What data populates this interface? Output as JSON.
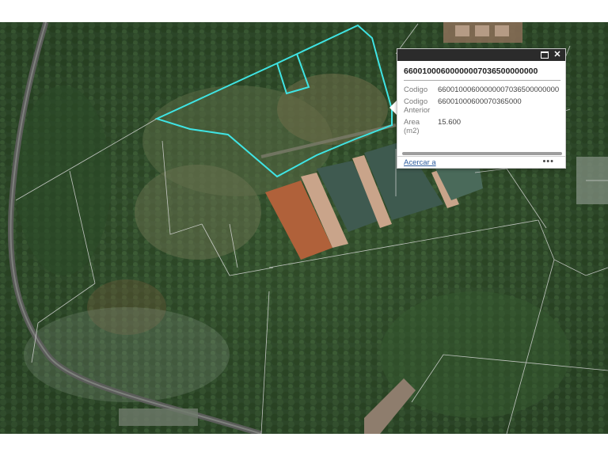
{
  "popup": {
    "title": "66001000600000007036500000000",
    "maximize_icon": "maximize-icon",
    "close_icon": "close-icon",
    "close_glyph": "✕",
    "attributes": [
      {
        "label": "Codigo",
        "value": "66001000600000007036500000000"
      },
      {
        "label": "Codigo Anterior",
        "value": "66001000600070365000"
      },
      {
        "label": "Area (m2)",
        "value": "15.600"
      }
    ],
    "zoom_link": "Acercar a",
    "more_glyph": "•••"
  },
  "map": {
    "selected_parcel_color": "#3fe4e4",
    "parcel_line_color": "#d9d9d9",
    "basemap": "satellite-imagery"
  }
}
